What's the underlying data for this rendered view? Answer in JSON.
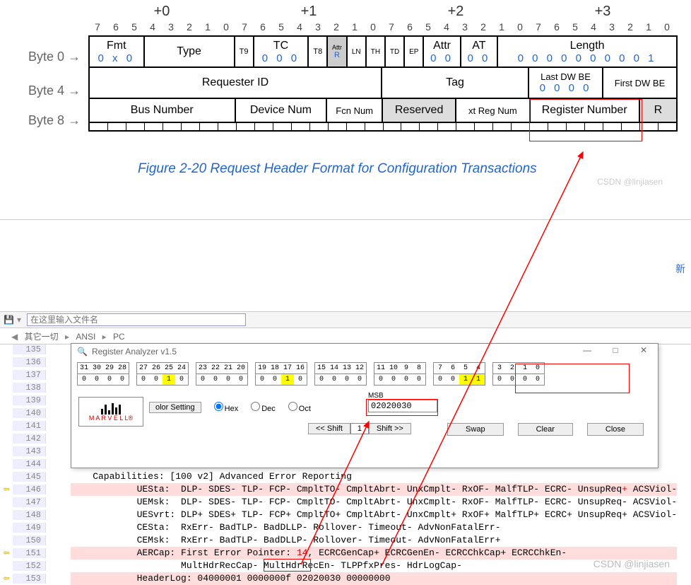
{
  "diagram": {
    "offsets": [
      "+0",
      "+1",
      "+2",
      "+3"
    ],
    "bits": [
      "7",
      "6",
      "5",
      "4",
      "3",
      "2",
      "1",
      "0"
    ],
    "byte_labels": [
      "Byte 0 →",
      "Byte 4 →",
      "Byte 8 →"
    ],
    "row0": {
      "fmt": {
        "label": "Fmt",
        "vals": "0 x 0"
      },
      "type": {
        "label": "Type"
      },
      "t9": "T9",
      "tc": {
        "label": "TC",
        "vals": "0 0 0"
      },
      "t8": "T8",
      "attrR": {
        "label": "Attr",
        "sub": "R"
      },
      "ln": "LN",
      "th": "TH",
      "td": "TD",
      "ep": "EP",
      "attr": {
        "label": "Attr",
        "vals": "0 0"
      },
      "at": {
        "label": "AT",
        "vals": "0 0"
      },
      "length": {
        "label": "Length",
        "vals": "0 0 0 0 0 0 0 0 0 1"
      }
    },
    "row1": {
      "requester": "Requester ID",
      "tag": "Tag",
      "lastdw": {
        "label": "Last DW BE",
        "vals": "0 0 0 0"
      },
      "firstdw": "First DW BE"
    },
    "row2": {
      "bus": "Bus Number",
      "dev": "Device Num",
      "fcn": "Fcn Num",
      "reserved": "Reserved",
      "extreg": "xt Reg Num",
      "regnum": "Register Number",
      "r": "R"
    },
    "caption": "Figure  2-20  Request Header Format for Configuration Transactions",
    "watermark": "CSDN @linjiasen"
  },
  "blue_char": "新",
  "toolbar": {
    "placeholder": "在这里输入文件名"
  },
  "tabs": {
    "t1": "其它一切",
    "t2": "ANSI",
    "t3": "PC"
  },
  "gutter": {
    "start": 135,
    "count": 19,
    "marks": {
      "146": true,
      "151": true,
      "153": true
    },
    "labels": {
      "146": "SViol",
      "147": "SViol",
      "148": "SViol"
    }
  },
  "popup": {
    "title": "Register Analyzer v1.5",
    "bitnums": [
      "31",
      "30",
      "29",
      "28",
      "27",
      "26",
      "25",
      "24",
      "23",
      "22",
      "21",
      "20",
      "19",
      "18",
      "17",
      "16",
      "15",
      "14",
      "13",
      "12",
      "11",
      "10",
      "9",
      "8",
      "7",
      "6",
      "5",
      "4",
      "3",
      "2",
      "1",
      "0"
    ],
    "bitvals": [
      "0",
      "0",
      "0",
      "0",
      "0",
      "0",
      "1",
      "0",
      "0",
      "0",
      "0",
      "0",
      "0",
      "0",
      "1",
      "0",
      "0",
      "0",
      "0",
      "0",
      "0",
      "0",
      "0",
      "0",
      "0",
      "0",
      "1",
      "1",
      "0",
      "0",
      "0",
      "0"
    ],
    "yellow_idx": [
      6,
      14,
      26,
      27
    ],
    "color_setting": "olor Setting",
    "hex": "Hex",
    "dec": "Dec",
    "oct": "Oct",
    "msb_label": "MSB",
    "msb_value": "02020030",
    "shift_left": "<< Shift",
    "shift_val": "1",
    "shift_right": "Shift >>",
    "swap": "Swap",
    "clear": "Clear",
    "close": "Close",
    "logo": "M A R V E L L®"
  },
  "code": {
    "lines": [
      {
        "n": 135,
        "t": ""
      },
      {
        "n": 136,
        "t": ""
      },
      {
        "n": 137,
        "t": ""
      },
      {
        "n": 138,
        "t": ""
      },
      {
        "n": 139,
        "t": ""
      },
      {
        "n": 140,
        "t": ""
      },
      {
        "n": 141,
        "t": ""
      },
      {
        "n": 142,
        "t": ""
      },
      {
        "n": 143,
        "t": ""
      },
      {
        "n": 144,
        "t": ""
      },
      {
        "n": 145,
        "t": "    Capabilities: [100 v2] Advanced Error Reporting"
      },
      {
        "n": 146,
        "t": "            UESta:  DLP- SDES- TLP- FCP- CmpltTO- CmpltAbrt- UnxCmplt- RxOF- MalfTLP- ECRC- UnsupReq",
        "hl": true,
        "tail": "+",
        "tail2": " ACSViol-"
      },
      {
        "n": 147,
        "t": "            UEMsk:  DLP- SDES- TLP- FCP- CmpltTO- CmpltAbrt- UnxCmplt- RxOF- MalfTLP- ECRC- UnsupReq- ACSViol-"
      },
      {
        "n": 148,
        "t": "            UESvrt: DLP+ SDES+ TLP- FCP+ CmpltTO+ CmpltAbrt- UnxCmplt+ RxOF+ MalfTLP+ ECRC+ UnsupReq+ ACSViol-"
      },
      {
        "n": 149,
        "t": "            CESta:  RxErr- BadTLP- BadDLLP- Rollover- Timeout- AdvNonFatalErr-"
      },
      {
        "n": 150,
        "t": "            CEMsk:  RxErr- BadTLP- BadDLLP- Rollover- Timeout- AdvNonFatalErr+"
      },
      {
        "n": 151,
        "t": "            AERCap: First Error Pointer: ",
        "hl": true,
        "red": "14",
        "tail": ", ECRCGenCap+ ECRCGenEn- ECRCChkCap+ ECRCChkEn-"
      },
      {
        "n": 152,
        "t": "                    MultHdrRecCap- MultHdrRecEn- TLPPfxPres- HdrLogCap-"
      },
      {
        "n": 153,
        "t": "            HeaderLog: 04000001 0000000f ",
        "hl": true,
        "box": "02020030",
        "tail": " 00000000"
      }
    ]
  }
}
